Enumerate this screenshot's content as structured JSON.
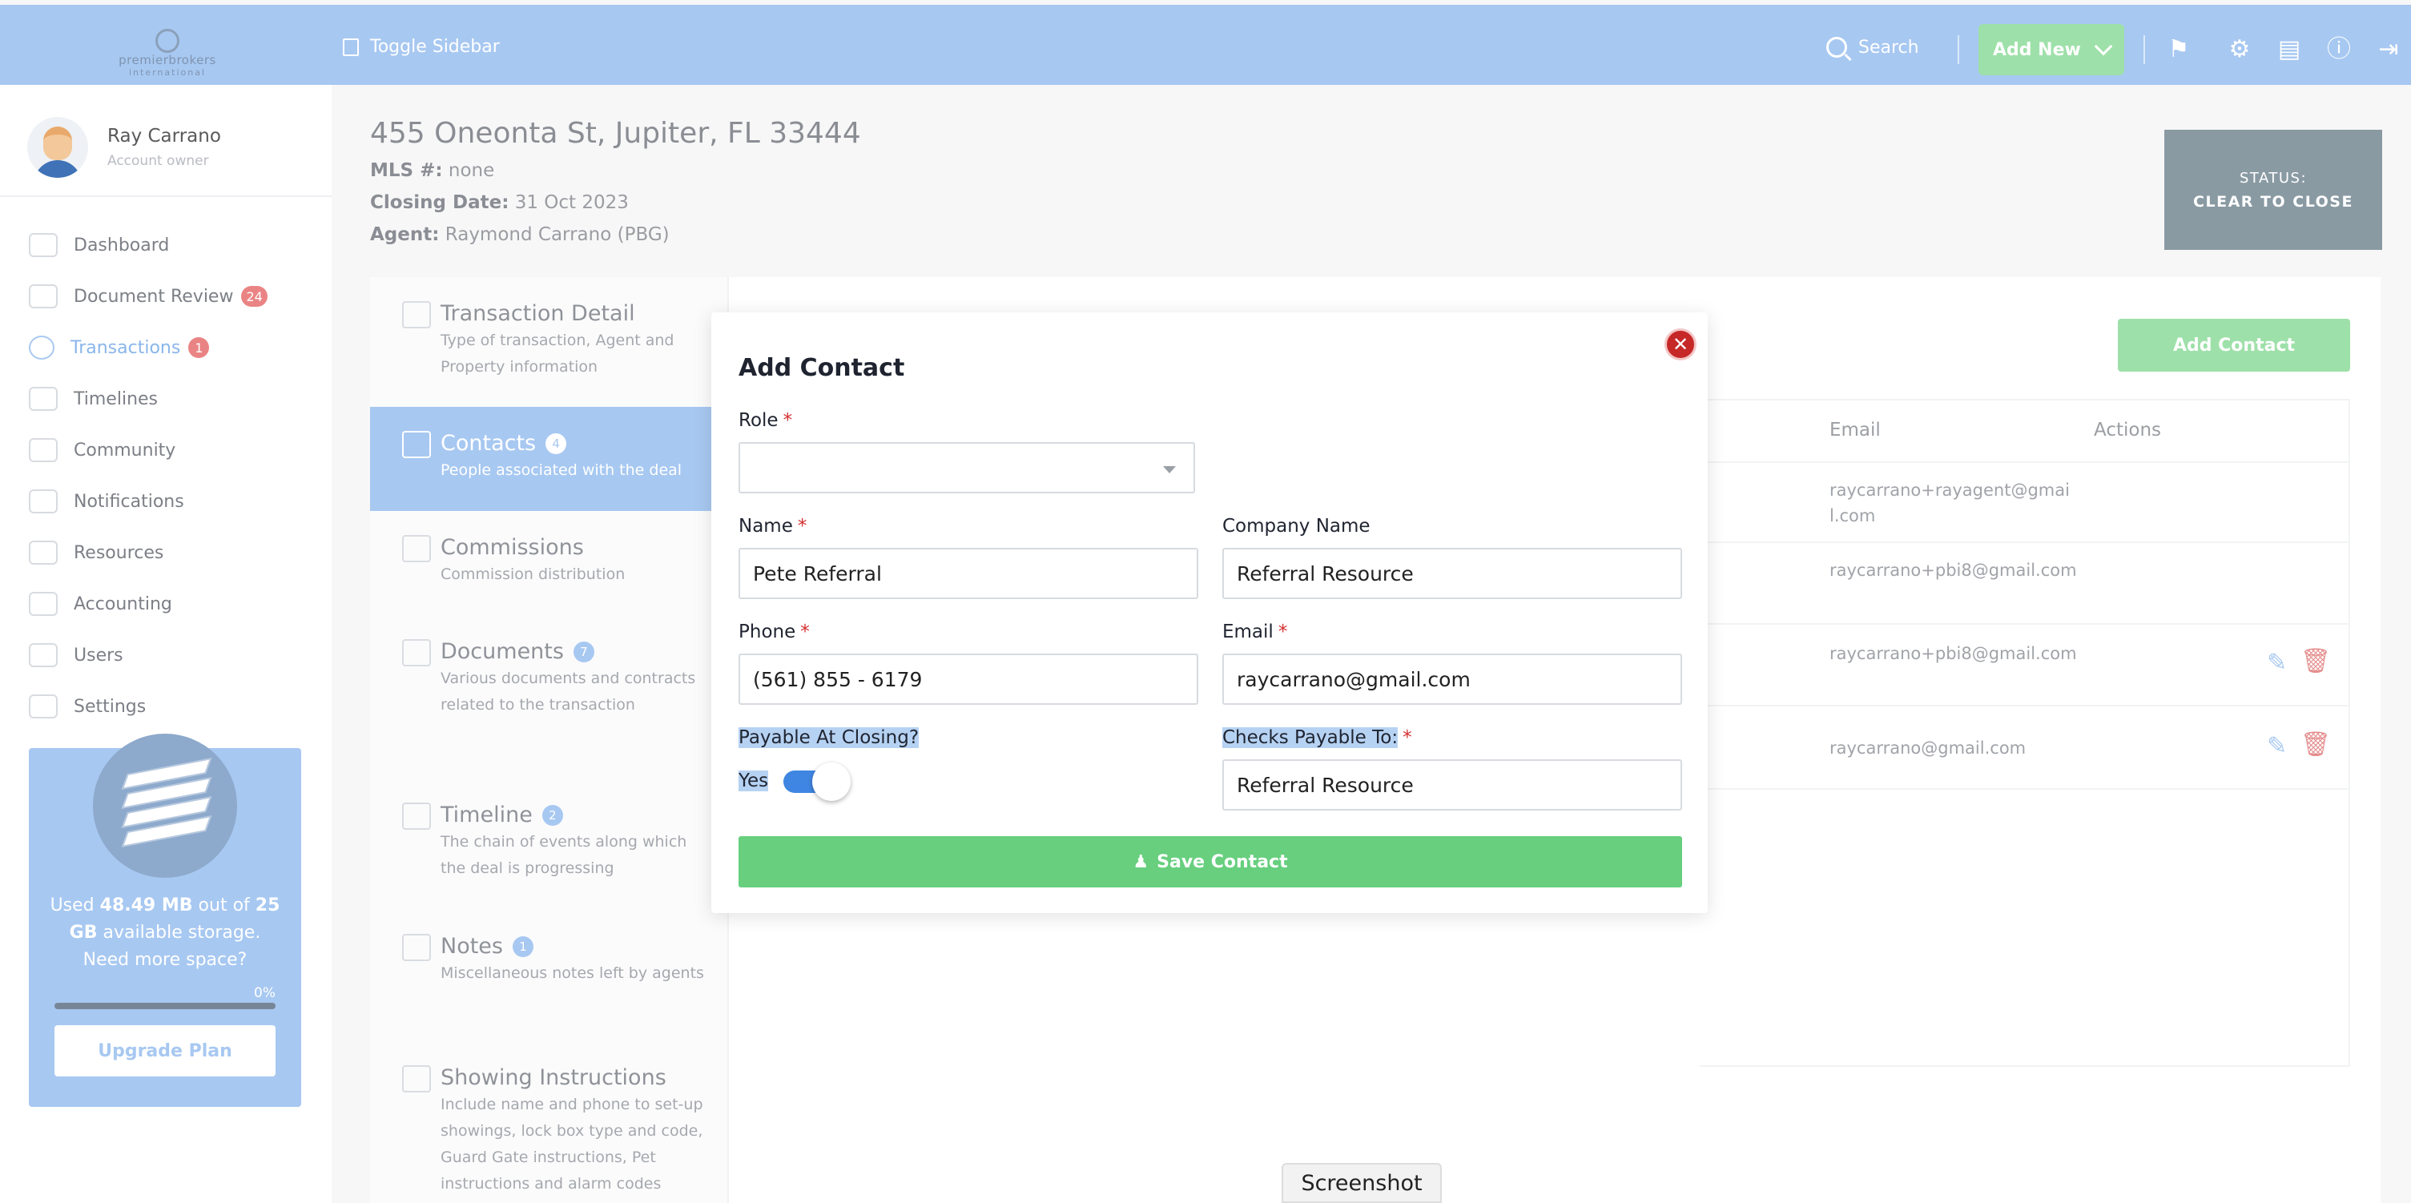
{
  "header": {
    "logo_line1": "premierbrokers",
    "logo_line2": "international",
    "toggle_label": "Toggle Sidebar",
    "search_label": "Search",
    "add_new_label": "Add New",
    "icons": [
      "megaphone-icon",
      "gear-icon",
      "clipboard-icon",
      "help-icon",
      "logout-icon"
    ]
  },
  "user": {
    "name": "Ray Carrano",
    "role": "Account owner"
  },
  "sidebar": {
    "items": [
      {
        "label": "Dashboard",
        "badge": "",
        "icon": "dashboard-icon"
      },
      {
        "label": "Document Review",
        "badge": "24",
        "icon": "document-review-icon"
      },
      {
        "label": "Transactions",
        "badge": "1",
        "icon": "dollar-icon"
      },
      {
        "label": "Timelines",
        "badge": "",
        "icon": "timeline-icon"
      },
      {
        "label": "Community",
        "badge": "",
        "icon": "community-icon"
      },
      {
        "label": "Notifications",
        "badge": "",
        "icon": "chat-icon"
      },
      {
        "label": "Resources",
        "badge": "",
        "icon": "resources-icon"
      },
      {
        "label": "Accounting",
        "badge": "",
        "icon": "accounting-icon"
      },
      {
        "label": "Users",
        "badge": "",
        "icon": "user-icon"
      },
      {
        "label": "Settings",
        "badge": "",
        "icon": "gear-icon"
      }
    ],
    "active_index": 2
  },
  "storage": {
    "text_pre": "Used ",
    "used": "48.49 MB",
    "text_mid": " out of ",
    "total": "25 GB",
    "text_post": " available storage. Need more space?",
    "percent_label": "0%",
    "percent": 0,
    "upgrade_label": "Upgrade Plan"
  },
  "property": {
    "address": "455 Oneonta St, Jupiter, FL 33444",
    "mls_label": "MLS #:",
    "mls_value": "none",
    "closing_label": "Closing Date:",
    "closing_value": "31 Oct 2023",
    "agent_label": "Agent:",
    "agent_value": "Raymond Carrano (PBG)"
  },
  "status": {
    "label": "STATUS:",
    "value": "CLEAR TO CLOSE"
  },
  "tabs": [
    {
      "title": "Transaction Detail",
      "badge": "",
      "desc": "Type of transaction, Agent and Property information",
      "icon": "building-icon"
    },
    {
      "title": "Contacts",
      "badge": "4",
      "desc": "People associated with the deal",
      "icon": "contacts-icon"
    },
    {
      "title": "Commissions",
      "badge": "",
      "desc": "Commission distribution",
      "icon": "commission-icon"
    },
    {
      "title": "Documents",
      "badge": "7",
      "desc": "Various documents and contracts related to the transaction",
      "icon": "document-icon"
    },
    {
      "title": "Timeline",
      "badge": "2",
      "desc": "The chain of events along which the deal is progressing",
      "icon": "timeline-icon"
    },
    {
      "title": "Notes",
      "badge": "1",
      "desc": "Miscellaneous notes left by agents",
      "icon": "notes-icon"
    },
    {
      "title": "Showing Instructions",
      "badge": "",
      "desc": "Include name and phone to set-up showings, lock box type and code, Guard Gate instructions, Pet instructions and alarm codes",
      "icon": "house-icon"
    }
  ],
  "contacts": {
    "add_label": "Add Contact",
    "columns": [
      "Email",
      "Actions"
    ],
    "rows": [
      {
        "email": "raycarrano+rayagent@gmail.com",
        "editable": false
      },
      {
        "email": "raycarrano+pbi8@gmail.com",
        "editable": false
      },
      {
        "email": "raycarrano+pbi8@gmail.com",
        "editable": true
      },
      {
        "email": "raycarrano@gmail.com",
        "editable": true
      }
    ]
  },
  "modal": {
    "title": "Add Contact",
    "role_label": "Role",
    "role_value": "",
    "name_label": "Name",
    "name_value": "Pete Referral",
    "company_label": "Company Name",
    "company_value": "Referral Resource",
    "phone_label": "Phone",
    "phone_value": "(561) 855 - 6179",
    "email_label": "Email",
    "email_value": "raycarrano@gmail.com",
    "payable_label": "Payable At Closing?",
    "payable_value": "Yes",
    "payable_on": true,
    "checks_label": "Checks Payable To:",
    "checks_value": "Referral Resource",
    "save_label": "Save Contact",
    "required_mark": "*"
  },
  "screenshot_tab": "Screenshot"
}
